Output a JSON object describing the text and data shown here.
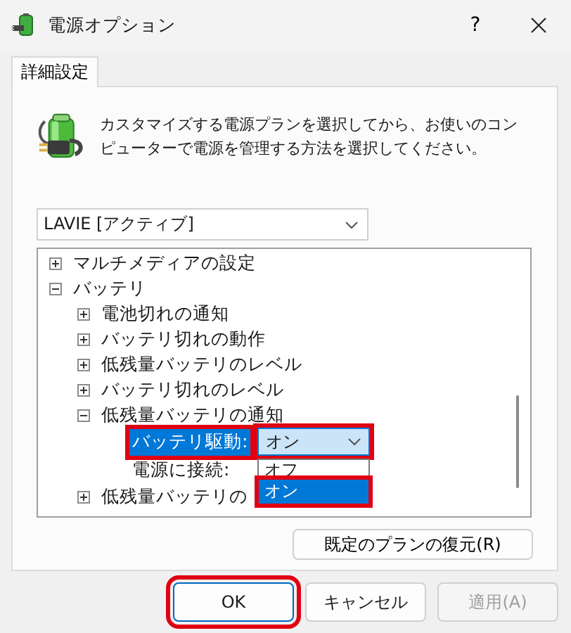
{
  "window": {
    "title": "電源オプション",
    "help_button": "?"
  },
  "tabs": [
    {
      "label": "詳細設定",
      "selected": true
    }
  ],
  "description": "カスタマイズする電源プランを選択してから、お使いのコンピューターで電源を管理する方法を選択してください。",
  "plan_select": {
    "value": "LAVIE [アクティブ]"
  },
  "tree": [
    {
      "kind": "group",
      "label": "マルチメディアの設定",
      "expanded": false
    },
    {
      "kind": "group",
      "label": "バッテリ",
      "expanded": true,
      "children": [
        {
          "kind": "group",
          "label": "電池切れの通知",
          "expanded": false
        },
        {
          "kind": "group",
          "label": "バッテリ切れの動作",
          "expanded": false
        },
        {
          "kind": "group",
          "label": "低残量バッテリのレベル",
          "expanded": false
        },
        {
          "kind": "group",
          "label": "バッテリ切れのレベル",
          "expanded": false
        },
        {
          "kind": "group",
          "label": "低残量バッテリの通知",
          "expanded": true,
          "children": [
            {
              "kind": "setting",
              "label": "バッテリ駆動:",
              "selected": true,
              "highlighted": true,
              "value": "オン",
              "dropdown": {
                "open": true,
                "highlighted": true,
                "options": [
                  {
                    "label": "オフ",
                    "selected": false,
                    "highlighted": false
                  },
                  {
                    "label": "オン",
                    "selected": true,
                    "highlighted": true
                  }
                ]
              }
            },
            {
              "kind": "setting",
              "label": "電源に接続:",
              "selected": false,
              "highlighted": false
            }
          ]
        },
        {
          "kind": "group",
          "label": "低残量バッテリの",
          "expanded": false
        }
      ]
    }
  ],
  "restore_button": "既定のプランの復元(R)",
  "buttons": [
    {
      "label": "OK",
      "default": true,
      "disabled": false,
      "highlighted": true
    },
    {
      "label": "キャンセル",
      "default": false,
      "disabled": false,
      "highlighted": false
    },
    {
      "label": "適用(A)",
      "default": false,
      "disabled": true,
      "highlighted": false
    }
  ]
}
